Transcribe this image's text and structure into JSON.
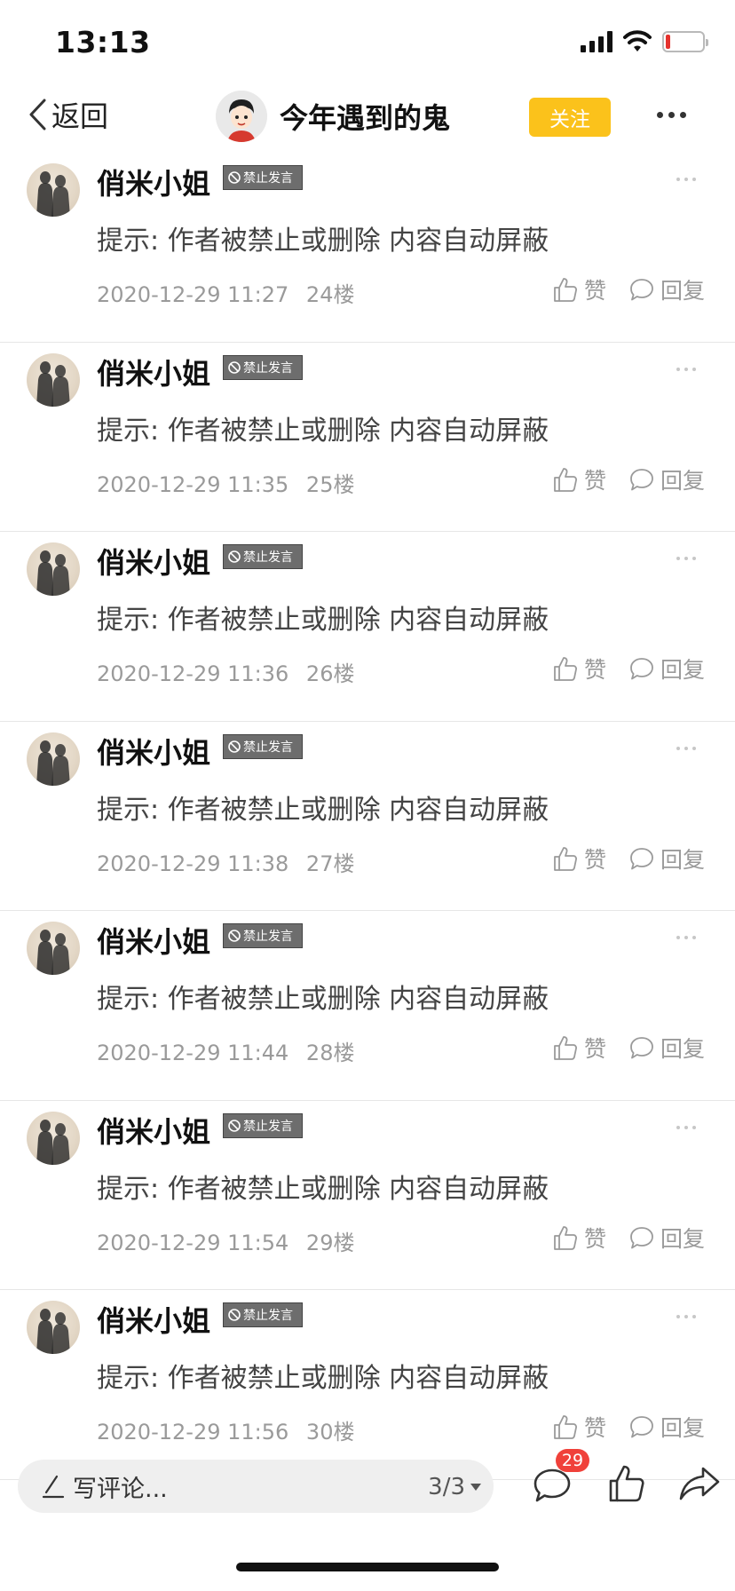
{
  "status_bar": {
    "time": "13:13",
    "battery_level": 0.08
  },
  "nav": {
    "back_label": "返回",
    "title": "今年遇到的鬼",
    "follow_label": "关注"
  },
  "posts": [
    {
      "username": "俏米小姐",
      "badge": "禁止发言",
      "content": "提示: 作者被禁止或删除 内容自动屏蔽",
      "datetime": "2020-12-29 11:27",
      "floor": "24楼",
      "like_label": "赞",
      "reply_label": "回复"
    },
    {
      "username": "俏米小姐",
      "badge": "禁止发言",
      "content": "提示: 作者被禁止或删除 内容自动屏蔽",
      "datetime": "2020-12-29 11:35",
      "floor": "25楼",
      "like_label": "赞",
      "reply_label": "回复"
    },
    {
      "username": "俏米小姐",
      "badge": "禁止发言",
      "content": "提示: 作者被禁止或删除 内容自动屏蔽",
      "datetime": "2020-12-29 11:36",
      "floor": "26楼",
      "like_label": "赞",
      "reply_label": "回复"
    },
    {
      "username": "俏米小姐",
      "badge": "禁止发言",
      "content": "提示: 作者被禁止或删除 内容自动屏蔽",
      "datetime": "2020-12-29 11:38",
      "floor": "27楼",
      "like_label": "赞",
      "reply_label": "回复"
    },
    {
      "username": "俏米小姐",
      "badge": "禁止发言",
      "content": "提示: 作者被禁止或删除 内容自动屏蔽",
      "datetime": "2020-12-29 11:44",
      "floor": "28楼",
      "like_label": "赞",
      "reply_label": "回复"
    },
    {
      "username": "俏米小姐",
      "badge": "禁止发言",
      "content": "提示: 作者被禁止或删除 内容自动屏蔽",
      "datetime": "2020-12-29 11:54",
      "floor": "29楼",
      "like_label": "赞",
      "reply_label": "回复"
    },
    {
      "username": "俏米小姐",
      "badge": "禁止发言",
      "content": "提示: 作者被禁止或删除 内容自动屏蔽",
      "datetime": "2020-12-29 11:56",
      "floor": "30楼",
      "like_label": "赞",
      "reply_label": "回复"
    }
  ],
  "bottom_bar": {
    "comment_placeholder": "写评论...",
    "page_indicator": "3/3",
    "comment_count": "29"
  },
  "colors": {
    "follow_button": "#fbc21b",
    "count_badge": "#f0413a",
    "battery_low": "#e5322d",
    "muted_text": "#9a9a9a"
  },
  "icons": [
    "back-chevron-icon",
    "wifi-icon",
    "signal-icon",
    "battery-icon",
    "more-icon",
    "ban-icon",
    "thumbs-up-icon",
    "comment-bubble-icon",
    "pencil-icon",
    "dropdown-triangle-icon",
    "share-arrow-icon"
  ]
}
